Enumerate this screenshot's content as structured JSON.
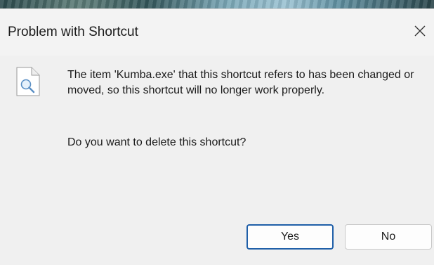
{
  "dialog": {
    "title": "Problem with Shortcut",
    "close_icon": "close-icon",
    "icon": "document-magnifier-icon",
    "message": "The item 'Kumba.exe' that this shortcut refers to has been changed or moved, so this shortcut will no longer work properly.",
    "question": "Do you want to delete this shortcut?",
    "buttons": {
      "yes_label": "Yes",
      "no_label": "No"
    },
    "accent_color": "#1f5fa8"
  }
}
